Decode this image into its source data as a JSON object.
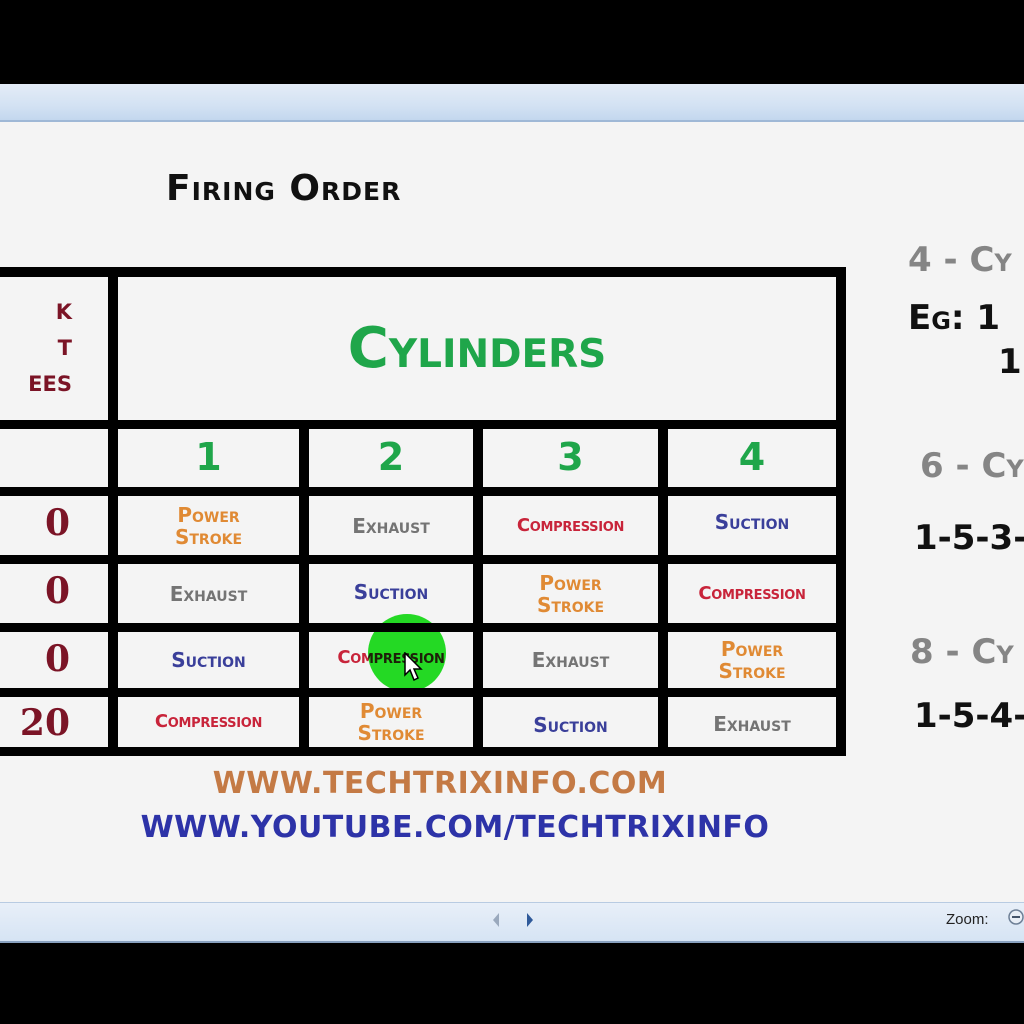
{
  "slide": {
    "title": "Firing Order",
    "crank_angle_label_lines": [
      "k",
      "t",
      "ees"
    ],
    "crank_angles_visible": [
      "0",
      "0",
      "0",
      "20"
    ],
    "cylinders_header": "Cylinders",
    "cylinder_numbers": [
      "1",
      "2",
      "3",
      "4"
    ],
    "rows": [
      [
        "Power Stroke",
        "Exhaust",
        "Compression",
        "Suction"
      ],
      [
        "Exhaust",
        "Suction",
        "Power Stroke",
        "Compression"
      ],
      [
        "Suction",
        "Compression",
        "Exhaust",
        "Power Stroke"
      ],
      [
        "Compression",
        "Power Stroke",
        "Suction",
        "Exhaust"
      ]
    ],
    "urls": {
      "website": "WWW.TECHTRIXINFO.COM",
      "youtube": "WWW.YOUTUBE.COM/TECHTRIXINFO"
    },
    "side_notes": {
      "four_cyl_heading": "4 - Cy",
      "four_cyl_example_1": "Eg: 1",
      "four_cyl_example_2": "1",
      "six_cyl_heading": "6 - Cy",
      "six_cyl_order": "1-5-3-",
      "eight_cyl_heading": "8 - Cy",
      "eight_cyl_order": "1-5-4-"
    },
    "colors": {
      "cylinders": "#1fa64a",
      "angles": "#7b1426",
      "power_stroke": "#e08a34",
      "exhaust": "#747474",
      "compression": "#c8243a",
      "suction": "#3a3f9a",
      "website": "#c47a45",
      "youtube": "#2d33a8"
    }
  },
  "statusbar": {
    "zoom_label": "Zoom:",
    "prev_icon": "arrow-left-icon",
    "next_icon": "arrow-right-icon",
    "zoom_icon": "zoom-out-icon"
  }
}
